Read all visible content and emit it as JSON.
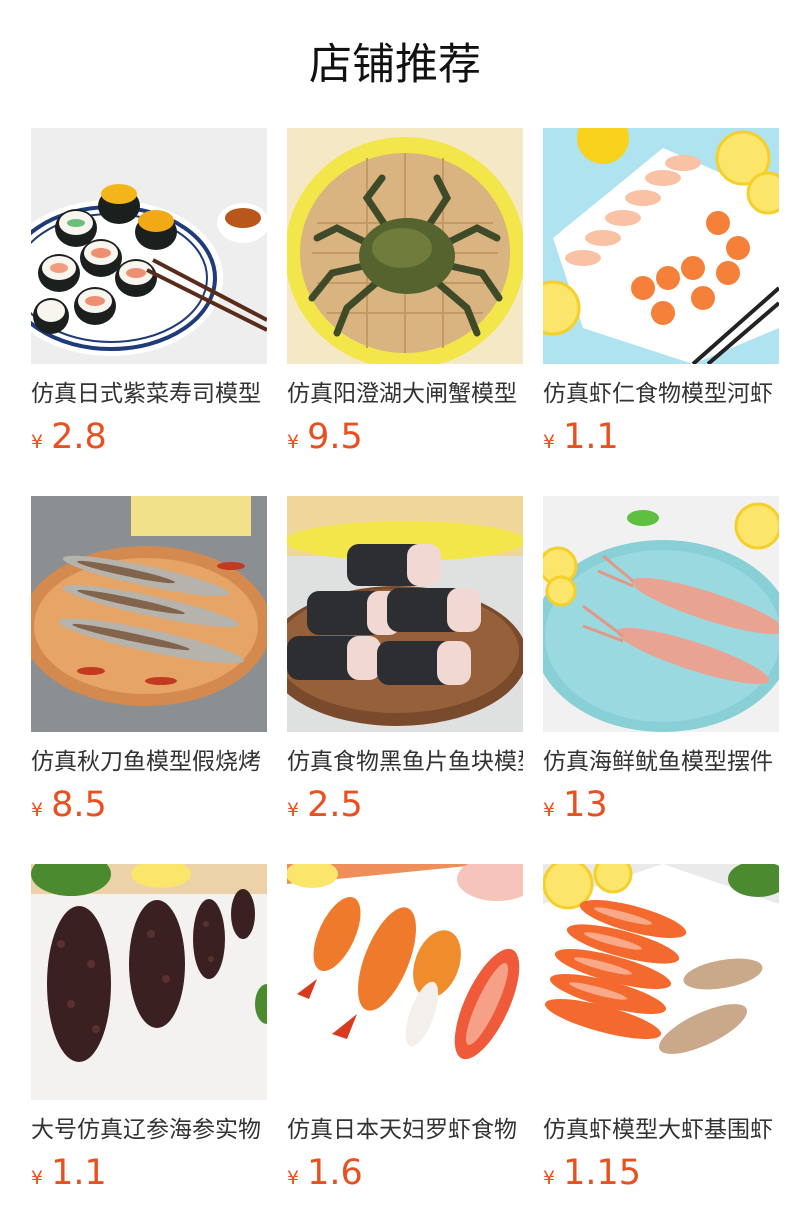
{
  "page": {
    "title": "店铺推荐",
    "currency_symbol": "¥",
    "accent_color": "#e8501f"
  },
  "products": [
    {
      "name": "仿真日式紫菜寿司模型",
      "price": "2.8",
      "image": "sushi-roll-plate-image"
    },
    {
      "name": "仿真阳澄湖大闸蟹模型",
      "price": "9.5",
      "image": "crab-steamer-image"
    },
    {
      "name": "仿真虾仁食物模型河虾",
      "price": "1.1",
      "image": "shrimp-plate-image"
    },
    {
      "name": "仿真秋刀鱼模型假烧烤",
      "price": "8.5",
      "image": "saury-fish-plate-image"
    },
    {
      "name": "仿真食物黑鱼片鱼块模型",
      "price": "2.5",
      "image": "fish-slices-image"
    },
    {
      "name": "仿真海鲜鱿鱼模型摆件",
      "price": "13",
      "image": "squid-plate-image"
    },
    {
      "name": "大号仿真辽参海参实物",
      "price": "1.1",
      "image": "sea-cucumber-image"
    },
    {
      "name": "仿真日本天妇罗虾食物",
      "price": "1.6",
      "image": "tempura-shrimp-image"
    },
    {
      "name": "仿真虾模型大虾基围虾",
      "price": "1.15",
      "image": "prawns-plate-image"
    }
  ]
}
